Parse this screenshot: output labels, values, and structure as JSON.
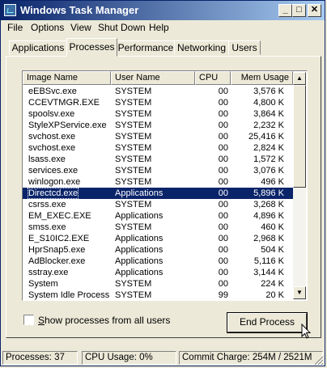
{
  "window": {
    "title": "Windows Task Manager"
  },
  "title_buttons": {
    "minimize": "_",
    "maximize": "□",
    "close": "✕"
  },
  "menu": [
    "File",
    "Options",
    "View",
    "Shut Down",
    "Help"
  ],
  "tabs": [
    "Applications",
    "Processes",
    "Performance",
    "Networking",
    "Users"
  ],
  "active_tab": "Processes",
  "columns": [
    "Image Name",
    "User Name",
    "CPU",
    "Mem Usage"
  ],
  "processes": [
    {
      "name": "eEBSvc.exe",
      "user": "SYSTEM",
      "cpu": "00",
      "mem": "3,576 K"
    },
    {
      "name": "CCEVTMGR.EXE",
      "user": "SYSTEM",
      "cpu": "00",
      "mem": "4,800 K"
    },
    {
      "name": "spoolsv.exe",
      "user": "SYSTEM",
      "cpu": "00",
      "mem": "3,864 K"
    },
    {
      "name": "StyleXPService.exe",
      "user": "SYSTEM",
      "cpu": "00",
      "mem": "2,232 K"
    },
    {
      "name": "svchost.exe",
      "user": "SYSTEM",
      "cpu": "00",
      "mem": "25,416 K"
    },
    {
      "name": "svchost.exe",
      "user": "SYSTEM",
      "cpu": "00",
      "mem": "2,824 K"
    },
    {
      "name": "lsass.exe",
      "user": "SYSTEM",
      "cpu": "00",
      "mem": "1,572 K"
    },
    {
      "name": "services.exe",
      "user": "SYSTEM",
      "cpu": "00",
      "mem": "3,076 K"
    },
    {
      "name": "winlogon.exe",
      "user": "SYSTEM",
      "cpu": "00",
      "mem": "496 K"
    },
    {
      "name": "Directcd.exe",
      "user": "Applications",
      "cpu": "00",
      "mem": "5,896 K",
      "selected": true
    },
    {
      "name": "csrss.exe",
      "user": "SYSTEM",
      "cpu": "00",
      "mem": "3,268 K"
    },
    {
      "name": "EM_EXEC.EXE",
      "user": "Applications",
      "cpu": "00",
      "mem": "4,896 K"
    },
    {
      "name": "smss.exe",
      "user": "SYSTEM",
      "cpu": "00",
      "mem": "460 K"
    },
    {
      "name": "E_S10IC2.EXE",
      "user": "Applications",
      "cpu": "00",
      "mem": "2,968 K"
    },
    {
      "name": "HprSnap5.exe",
      "user": "Applications",
      "cpu": "00",
      "mem": "504 K"
    },
    {
      "name": "AdBlocker.exe",
      "user": "Applications",
      "cpu": "00",
      "mem": "5,116 K"
    },
    {
      "name": "sstray.exe",
      "user": "Applications",
      "cpu": "00",
      "mem": "3,144 K"
    },
    {
      "name": "System",
      "user": "SYSTEM",
      "cpu": "00",
      "mem": "224 K"
    },
    {
      "name": "System Idle Process",
      "user": "SYSTEM",
      "cpu": "99",
      "mem": "20 K"
    }
  ],
  "show_all_label": "Show processes from all users",
  "show_all_checked": false,
  "end_process_label": "End Process",
  "status": {
    "processes": "Processes: 37",
    "cpu": "CPU Usage: 0%",
    "commit": "Commit Charge: 254M / 2521M"
  },
  "colors": {
    "title_start": "#0a246a",
    "title_end": "#a6caf0",
    "selection": "#0a246a",
    "face": "#ece9d8"
  }
}
